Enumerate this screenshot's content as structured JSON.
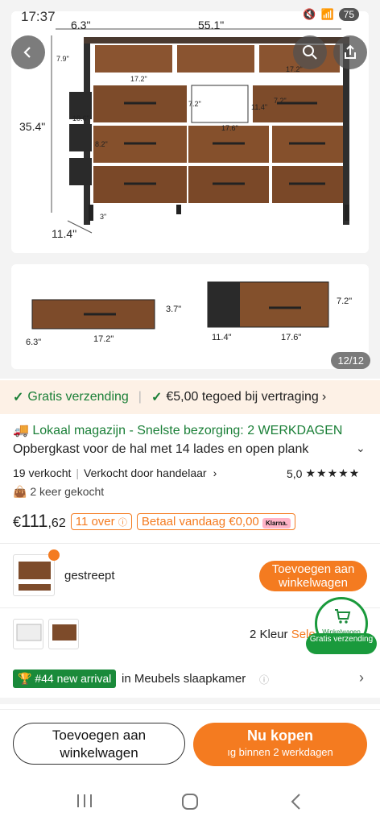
{
  "status": {
    "time": "17:37",
    "battery": "75"
  },
  "gallery": {
    "counter": "12/12",
    "dims_main": {
      "d_top": "6.3\"",
      "w_top": "55.1\"",
      "h_left": "35.4\"",
      "d_bottom": "11.4\"",
      "h_top_drawer": "7.9\"",
      "w_mid": "17.2\"",
      "w_right": "17.2\"",
      "h_open": "7.2\"",
      "w_open": "11.4\"",
      "h_right": "7.2\"",
      "bin_d": "10.6\"",
      "bin_h": "8.2\"",
      "w_center": "17.6\"",
      "leg": "3\""
    },
    "dims_small": {
      "a_h": "3.7\"",
      "a_w": "17.2\"",
      "a_d": "6.3\"",
      "b_h": "7.2\"",
      "b_d": "11.4\"",
      "b_w": "17.6\""
    }
  },
  "shipping": {
    "free": "Gratis verzending",
    "credit": "€5,00 tegoed bij vertraging"
  },
  "product": {
    "local": "Lokaal magazijn - Snelste bezorging: 2 WERKDAGEN",
    "title": "Opbergkast voor de hal met 14 lades en open plank",
    "sold": "19 verkocht",
    "seller": "Verkocht door handelaar",
    "rating": "5,0",
    "bought": "2 keer gekocht",
    "price_currency": "€",
    "price_int": "111",
    "price_dec": ",62",
    "left": "11 over",
    "pay_today": "Betaal vandaag €0,00",
    "klarna": "Klarna."
  },
  "variant": {
    "name": "gestreept",
    "add_cart": "Toevoegen aan winkelwagen"
  },
  "colors": {
    "count": "2 Kleur",
    "select": "Sele"
  },
  "cart_bubble": {
    "label": "Winkelwagen",
    "free": "Gratis verzending"
  },
  "ranking": {
    "badge": "#44 new arrival",
    "category": "in Meubels slaapkamer"
  },
  "bottom": {
    "add_cart": "Toevoegen aan winkelwagen",
    "buy_now": "Nu kopen",
    "buy_sub": "ıg binnen 2 werkdagen"
  },
  "accent": "#f47b20",
  "green": "#1a7f37"
}
